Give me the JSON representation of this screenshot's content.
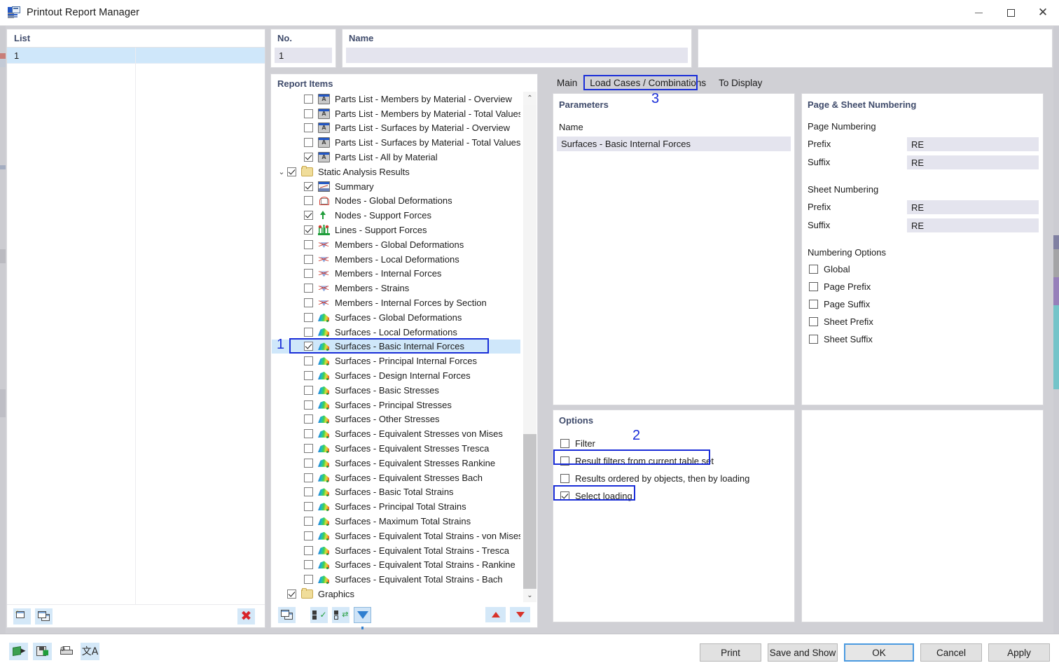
{
  "window": {
    "title": "Printout Report Manager",
    "icon": "report-manager-icon",
    "minimize": "–",
    "maximize": "□",
    "close": "✕"
  },
  "list_panel": {
    "header": "List",
    "rows": [
      "1"
    ],
    "toolbar": [
      {
        "name": "new-report-button",
        "icon": "new-window-icon"
      },
      {
        "name": "copy-report-button",
        "icon": "copy-window-icon"
      },
      {
        "name": "delete-report-button",
        "icon": "delete-x-icon",
        "glyph": "✖"
      }
    ]
  },
  "fields": {
    "no_label": "No.",
    "no_value": "1",
    "name_label": "Name",
    "name_value": ""
  },
  "report_items": {
    "header": "Report Items",
    "items": [
      {
        "label": "Parts List - Members by Material - Overview",
        "checked": false,
        "icon": "parts-list-icon",
        "level": 1,
        "twisty": ""
      },
      {
        "label": "Parts List - Members by Material - Total Values",
        "checked": false,
        "icon": "parts-list-icon",
        "level": 1,
        "twisty": ""
      },
      {
        "label": "Parts List - Surfaces by Material - Overview",
        "checked": false,
        "icon": "parts-list-icon",
        "level": 1,
        "twisty": ""
      },
      {
        "label": "Parts List - Surfaces by Material - Total Values",
        "checked": false,
        "icon": "parts-list-icon",
        "level": 1,
        "twisty": ""
      },
      {
        "label": "Parts List - All by Material",
        "checked": true,
        "icon": "parts-list-icon",
        "level": 1,
        "twisty": ""
      },
      {
        "label": "Static Analysis Results",
        "checked": true,
        "icon": "folder-icon",
        "level": 0,
        "twisty": "⌄"
      },
      {
        "label": "Summary",
        "checked": true,
        "icon": "summary-icon",
        "level": 1,
        "twisty": ""
      },
      {
        "label": "Nodes - Global Deformations",
        "checked": false,
        "icon": "node-icon",
        "level": 1,
        "twisty": ""
      },
      {
        "label": "Nodes - Support Forces",
        "checked": true,
        "icon": "support-force-icon",
        "level": 1,
        "twisty": ""
      },
      {
        "label": "Lines - Support Forces",
        "checked": true,
        "icon": "line-support-icon",
        "level": 1,
        "twisty": ""
      },
      {
        "label": "Members - Global Deformations",
        "checked": false,
        "icon": "member-icon",
        "level": 1,
        "twisty": ""
      },
      {
        "label": "Members - Local Deformations",
        "checked": false,
        "icon": "member-icon",
        "level": 1,
        "twisty": ""
      },
      {
        "label": "Members - Internal Forces",
        "checked": false,
        "icon": "member-icon",
        "level": 1,
        "twisty": ""
      },
      {
        "label": "Members - Strains",
        "checked": false,
        "icon": "member-icon",
        "level": 1,
        "twisty": ""
      },
      {
        "label": "Members - Internal Forces by Section",
        "checked": false,
        "icon": "member-icon",
        "level": 1,
        "twisty": ""
      },
      {
        "label": "Surfaces - Global Deformations",
        "checked": false,
        "icon": "surface-icon",
        "level": 1,
        "twisty": ""
      },
      {
        "label": "Surfaces - Local Deformations",
        "checked": false,
        "icon": "surface-icon",
        "level": 1,
        "twisty": ""
      },
      {
        "label": "Surfaces - Basic Internal Forces",
        "checked": true,
        "icon": "surface-icon",
        "level": 1,
        "twisty": "",
        "selected": true
      },
      {
        "label": "Surfaces - Principal Internal Forces",
        "checked": false,
        "icon": "surface-icon",
        "level": 1,
        "twisty": ""
      },
      {
        "label": "Surfaces - Design Internal Forces",
        "checked": false,
        "icon": "surface-icon",
        "level": 1,
        "twisty": ""
      },
      {
        "label": "Surfaces - Basic Stresses",
        "checked": false,
        "icon": "surface-icon",
        "level": 1,
        "twisty": ""
      },
      {
        "label": "Surfaces - Principal Stresses",
        "checked": false,
        "icon": "surface-icon",
        "level": 1,
        "twisty": ""
      },
      {
        "label": "Surfaces - Other Stresses",
        "checked": false,
        "icon": "surface-icon",
        "level": 1,
        "twisty": ""
      },
      {
        "label": "Surfaces - Equivalent Stresses von Mises",
        "checked": false,
        "icon": "surface-icon",
        "level": 1,
        "twisty": ""
      },
      {
        "label": "Surfaces - Equivalent Stresses Tresca",
        "checked": false,
        "icon": "surface-icon",
        "level": 1,
        "twisty": ""
      },
      {
        "label": "Surfaces - Equivalent Stresses Rankine",
        "checked": false,
        "icon": "surface-icon",
        "level": 1,
        "twisty": ""
      },
      {
        "label": "Surfaces - Equivalent Stresses Bach",
        "checked": false,
        "icon": "surface-icon",
        "level": 1,
        "twisty": ""
      },
      {
        "label": "Surfaces - Basic Total Strains",
        "checked": false,
        "icon": "surface-icon",
        "level": 1,
        "twisty": ""
      },
      {
        "label": "Surfaces - Principal Total Strains",
        "checked": false,
        "icon": "surface-icon",
        "level": 1,
        "twisty": ""
      },
      {
        "label": "Surfaces - Maximum Total Strains",
        "checked": false,
        "icon": "surface-icon",
        "level": 1,
        "twisty": ""
      },
      {
        "label": "Surfaces - Equivalent Total Strains - von Mises",
        "checked": false,
        "icon": "surface-icon",
        "level": 1,
        "twisty": ""
      },
      {
        "label": "Surfaces - Equivalent Total Strains - Tresca",
        "checked": false,
        "icon": "surface-icon",
        "level": 1,
        "twisty": ""
      },
      {
        "label": "Surfaces - Equivalent Total Strains - Rankine",
        "checked": false,
        "icon": "surface-icon",
        "level": 1,
        "twisty": ""
      },
      {
        "label": "Surfaces - Equivalent Total Strains - Bach",
        "checked": false,
        "icon": "surface-icon",
        "level": 1,
        "twisty": ""
      },
      {
        "label": "Graphics",
        "checked": true,
        "icon": "folder-icon",
        "level": 0,
        "twisty": ""
      }
    ],
    "toolbar": [
      {
        "name": "new-item-button",
        "icon": "copy-window-icon"
      },
      {
        "name": "select-all-button",
        "icon": "check-all-icon"
      },
      {
        "name": "invert-selection-button",
        "icon": "invert-selection-icon"
      },
      {
        "name": "filter-button",
        "icon": "funnel-icon",
        "active": true
      },
      {
        "name": "move-up-button",
        "icon": "triangle-up-icon"
      },
      {
        "name": "move-down-button",
        "icon": "triangle-down-icon"
      }
    ],
    "scroll_up": "⌃",
    "scroll_down": "⌄"
  },
  "tabs": [
    {
      "label": "Main",
      "active": false
    },
    {
      "label": "Load Cases / Combinations",
      "active": true
    },
    {
      "label": "To Display",
      "active": false
    }
  ],
  "parameters": {
    "title": "Parameters",
    "name_label": "Name",
    "rows": [
      "Surfaces - Basic Internal Forces"
    ]
  },
  "options": {
    "title": "Options",
    "items": [
      {
        "label": "Filter",
        "checked": false
      },
      {
        "label": "Result filters from current table set",
        "checked": false,
        "highlighted": true
      },
      {
        "label": "Results ordered by objects, then by loading",
        "checked": false
      },
      {
        "label": "Select loading",
        "checked": true,
        "highlighted": true
      }
    ]
  },
  "numbering": {
    "title": "Page & Sheet Numbering",
    "page_group": "Page Numbering",
    "page_prefix_label": "Prefix",
    "page_prefix_value": "RE",
    "page_suffix_label": "Suffix",
    "page_suffix_value": "RE",
    "sheet_group": "Sheet Numbering",
    "sheet_prefix_label": "Prefix",
    "sheet_prefix_value": "RE",
    "sheet_suffix_label": "Suffix",
    "sheet_suffix_value": "RE",
    "options_group": "Numbering Options",
    "options": [
      {
        "label": "Global",
        "checked": false
      },
      {
        "label": "Page Prefix",
        "checked": false
      },
      {
        "label": "Page Suffix",
        "checked": false
      },
      {
        "label": "Sheet Prefix",
        "checked": false
      },
      {
        "label": "Sheet Suffix",
        "checked": false
      }
    ]
  },
  "bottom": {
    "tools": [
      {
        "name": "export-button",
        "icon": "export-icon"
      },
      {
        "name": "save-button",
        "icon": "save-icon"
      },
      {
        "name": "print-settings-button",
        "icon": "printer-gear-icon"
      },
      {
        "name": "language-button",
        "icon": "translate-icon",
        "glyph": "文A"
      }
    ],
    "buttons": [
      {
        "label": "Print",
        "name": "print-button",
        "default": false
      },
      {
        "label": "Save and Show",
        "name": "save-and-show-button",
        "default": false
      },
      {
        "label": "OK",
        "name": "ok-button",
        "default": true
      },
      {
        "label": "Cancel",
        "name": "cancel-button",
        "default": false
      },
      {
        "label": "Apply",
        "name": "apply-button",
        "default": false
      }
    ]
  },
  "annotations": [
    {
      "number": "1",
      "target": "tree-item-surfaces-basic-internal-forces"
    },
    {
      "number": "2",
      "target": "options-result-filters"
    },
    {
      "number": "3",
      "target": "tab-load-cases-combinations"
    }
  ],
  "colors": {
    "accent_blue": "#1a2ed8",
    "selection_blue": "#cfe7fa",
    "field_lavender": "#e4e4ee",
    "group_title": "#3f4b6b",
    "window_bg": "#d0d0d5"
  }
}
